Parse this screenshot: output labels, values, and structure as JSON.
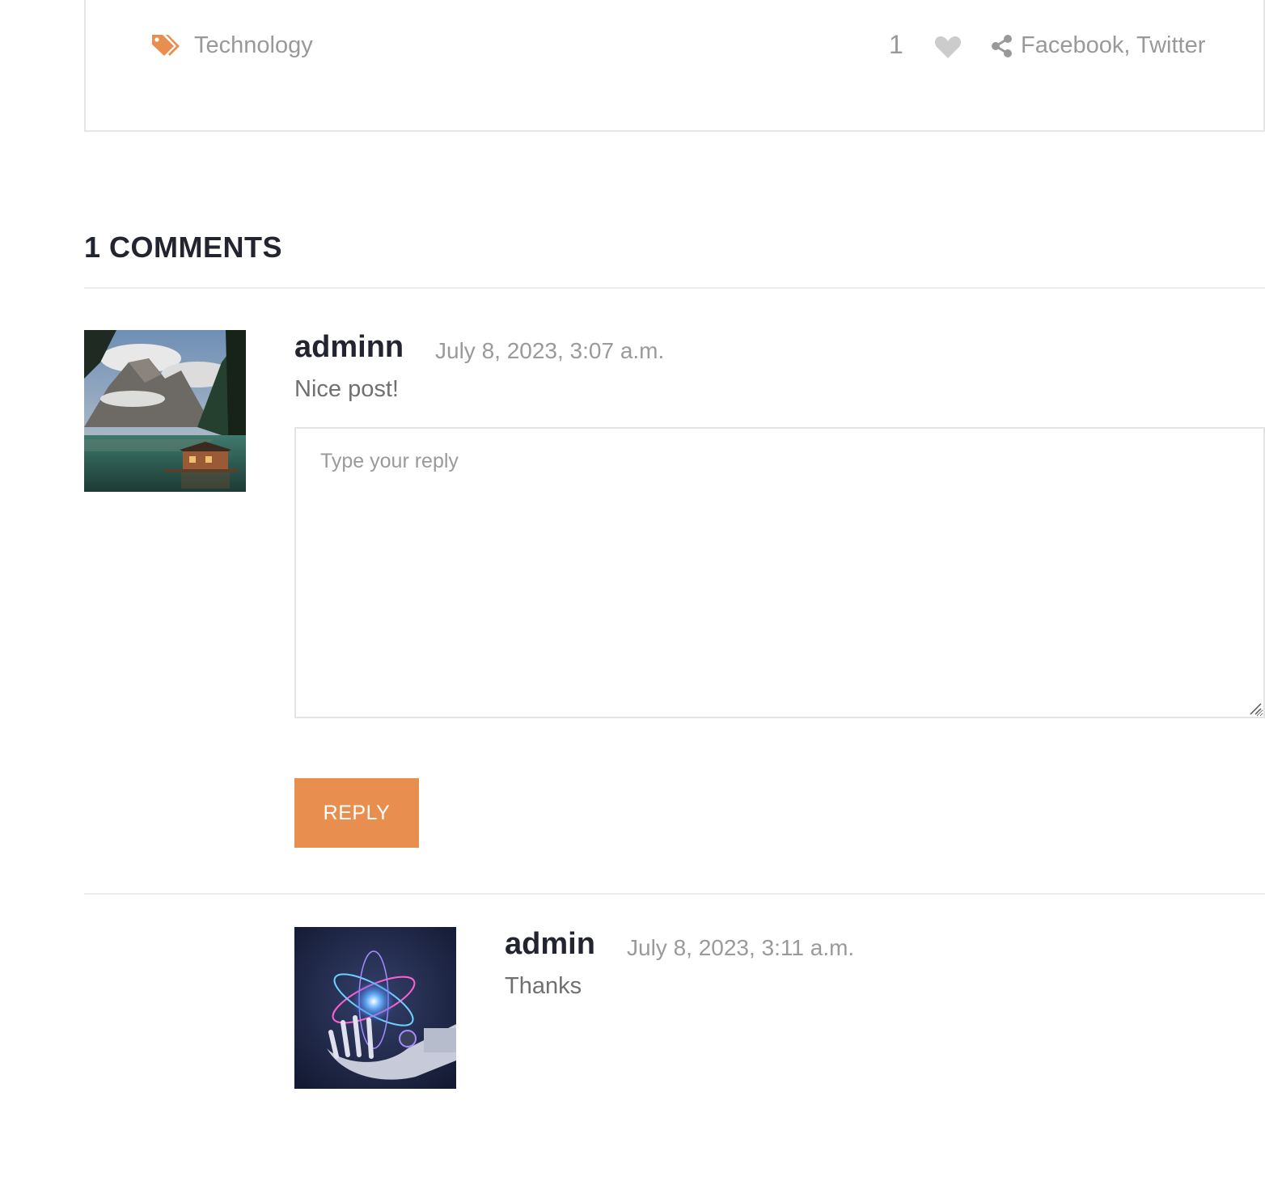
{
  "post_meta": {
    "tag": "Technology",
    "like_count": "1",
    "share_facebook": "Facebook",
    "share_separator": ", ",
    "share_twitter": "Twitter",
    "accent_color": "#e88f50",
    "icon_color": "#cccccc"
  },
  "comments_section": {
    "title": "1 COMMENTS"
  },
  "comments": [
    {
      "author": "adminn",
      "date": "July 8, 2023, 3:07 a.m.",
      "text": "Nice post!",
      "avatar": "mountain-lake-cabin-photo"
    },
    {
      "author": "admin",
      "date": "July 8, 2023, 3:11 a.m.",
      "text": "Thanks",
      "avatar": "robot-hand-atom-photo"
    }
  ],
  "reply_form": {
    "placeholder": "Type your reply",
    "button_label": "REPLY"
  },
  "icons": {
    "tag": "tags-icon",
    "like": "heart-icon",
    "share": "share-icon"
  }
}
